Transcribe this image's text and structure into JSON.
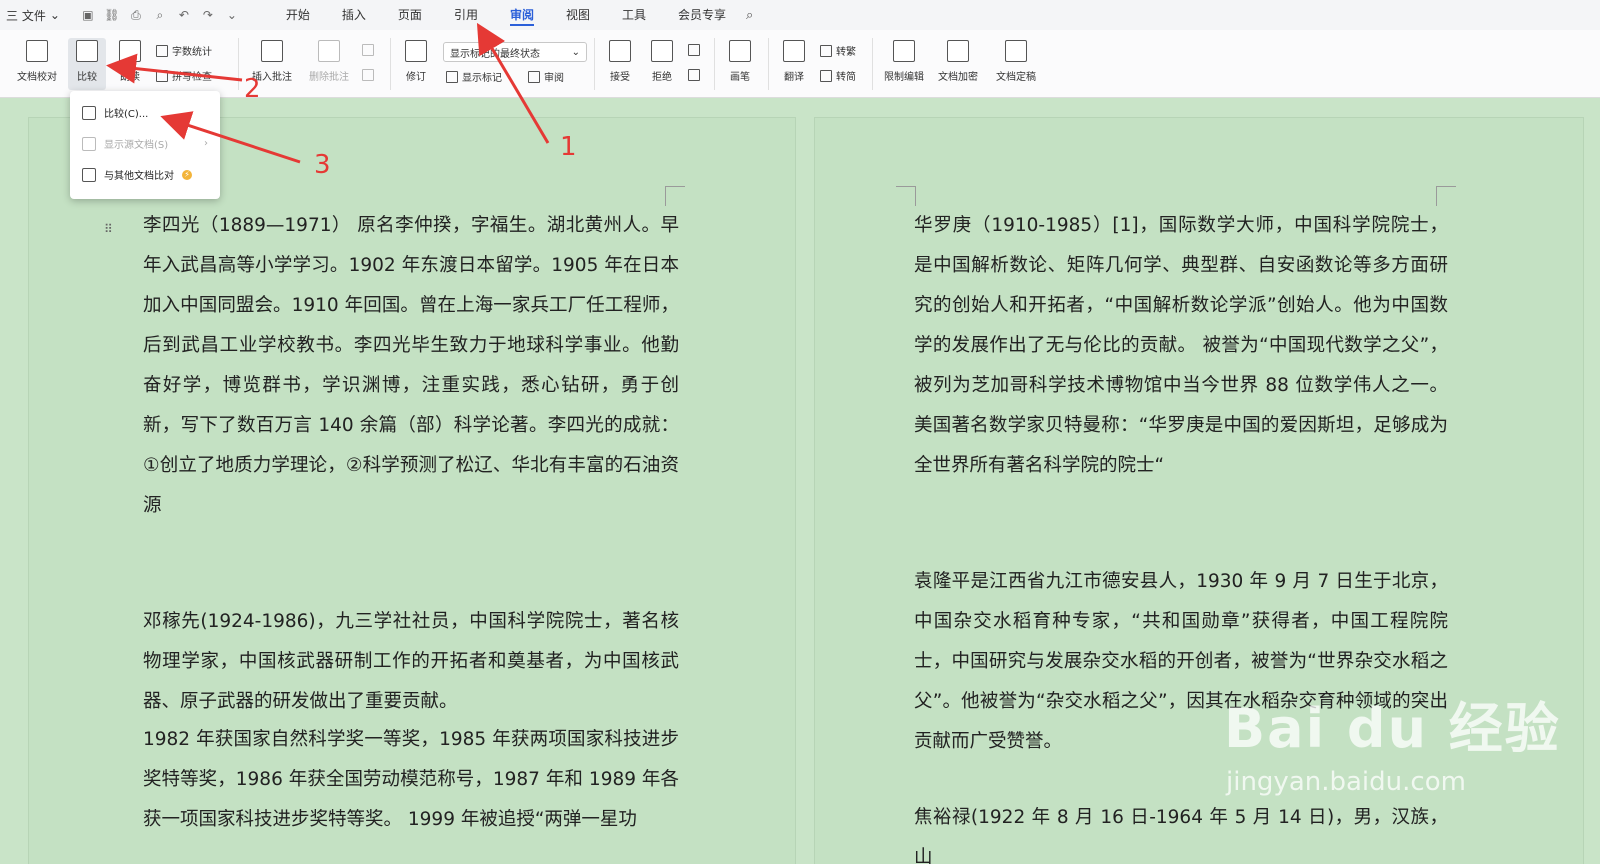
{
  "menubar": {
    "file_label": "三 文件",
    "file_caret": "⌄",
    "tabs": [
      {
        "label": "开始"
      },
      {
        "label": "插入"
      },
      {
        "label": "页面"
      },
      {
        "label": "引用"
      },
      {
        "label": "审阅"
      },
      {
        "label": "视图"
      },
      {
        "label": "工具"
      },
      {
        "label": "会员专享"
      }
    ],
    "active_tab": "审阅"
  },
  "ribbon": {
    "doc_proof": "文档校对",
    "compare": "比较",
    "read_aloud": "朗读",
    "word_count": "字数统计",
    "spell_check": "拼写检查",
    "insert_comment": "插入批注",
    "delete_comment": "删除批注",
    "revise": "修订",
    "show_markup_select": "显示标记的最终状态",
    "show_markup": "显示标记",
    "review": "审阅",
    "accept": "接受",
    "reject": "拒绝",
    "pen": "画笔",
    "translate": "翻译",
    "to_traditional": "转繁",
    "to_simplified": "转简",
    "restrict_edit": "限制编辑",
    "encrypt": "文档加密",
    "finalize": "文档定稿"
  },
  "compare_menu": {
    "items": [
      {
        "label": "比较(C)..."
      },
      {
        "label": "显示源文档(S)"
      },
      {
        "label": "与其他文档比对"
      }
    ]
  },
  "annotations": {
    "n1": "1",
    "n2": "2",
    "n3": "3"
  },
  "doc_left": {
    "p1": "李四光（1889—1971） 原名李仲揆，字福生。湖北黄州人。早年入武昌高等小学学习。1902 年东渡日本留学。1905 年在日本加入中国同盟会。1910 年回国。曾在上海一家兵工厂任工程师，后到武昌工业学校教书。李四光毕生致力于地球科学事业。他勤奋好学，博览群书，学识渊博，注重实践，悉心钻研，勇于创新，写下了数百万言 140 余篇（部）科学论著。李四光的成就：①创立了地质力学理论，②科学预测了松辽、华北有丰富的石油资源",
    "p2": "邓稼先(1924-1986)，九三学社社员，中国科学院院士，著名核物理学家，中国核武器研制工作的开拓者和奠基者，为中国核武器、原子武器的研发做出了重要贡献。",
    "p3": "1982 年获国家自然科学奖一等奖，1985 年获两项国家科技进步奖特等奖，1986 年获全国劳动模范称号，1987 年和 1989 年各获一项国家科技进步奖特等奖。 1999 年被追授“两弹一星功"
  },
  "doc_right": {
    "p1": "华罗庚（1910-1985）[1]，国际数学大师，中国科学院院士，是中国解析数论、矩阵几何学、典型群、自安函数论等多方面研究的创始人和开拓者，“中国解析数论学派”创始人。他为中国数学的发展作出了无与伦比的贡献。 被誉为“中国现代数学之父”，被列为芝加哥科学技术博物馆中当今世界 88 位数学伟人之一。美国著名数学家贝特曼称：“华罗庚是中国的爱因斯坦，足够成为全世界所有著名科学院的院士“",
    "p2": "袁隆平是江西省九江市德安县人，1930 年 9 月 7 日生于北京，中国杂交水稻育种专家，“共和国勋章”获得者，中国工程院院士，中国研究与发展杂交水稻的开创者，被誉为“世界杂交水稻之父”。他被誉为“杂交水稻之父”，因其在水稻杂交育种领域的突出贡献而广受赞誉。",
    "p3": "焦裕禄(1922 年 8 月 16 日-1964 年 5 月 14 日)，男，汉族，山"
  },
  "watermark": {
    "brand": "Bai du 经验",
    "url": "jingyan.baidu.com"
  },
  "colors": {
    "page_bg": "#c9e4c8",
    "accent": "#2b5fd9",
    "annotation": "#e53935"
  }
}
